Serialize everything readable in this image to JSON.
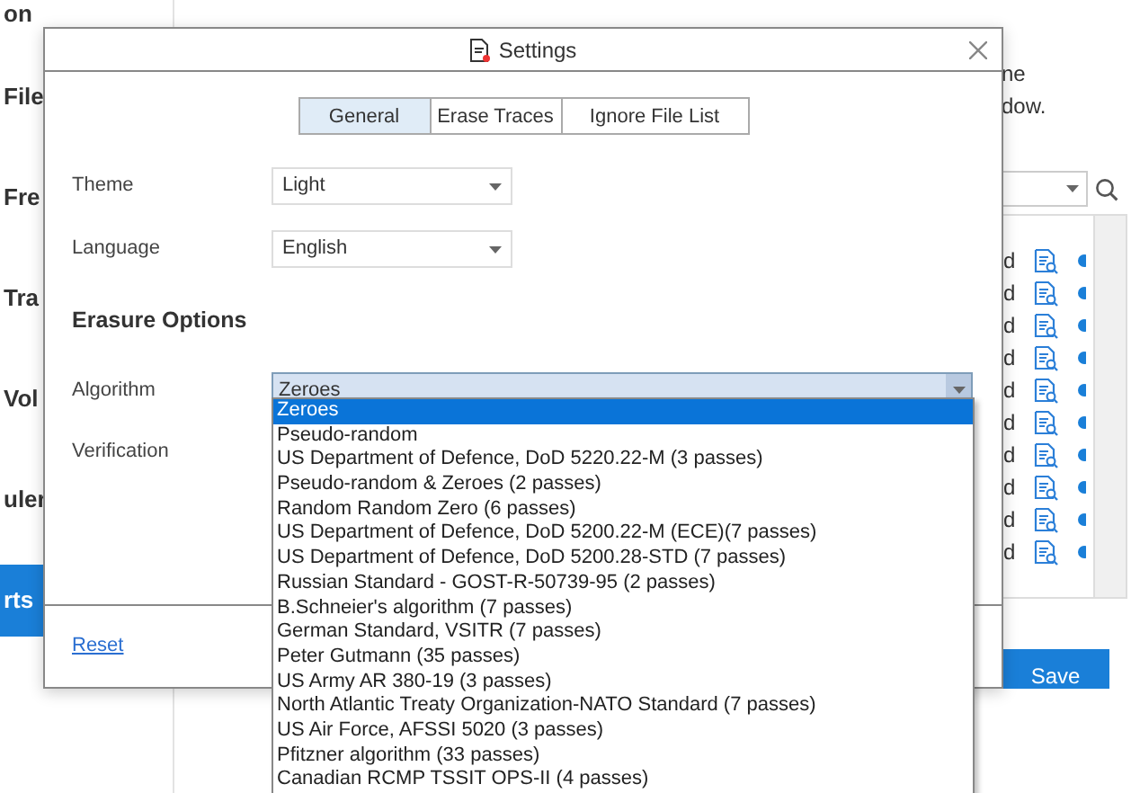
{
  "background": {
    "sidebar": [
      {
        "label": "on",
        "selected": false
      },
      {
        "label": "File",
        "selected": false
      },
      {
        "label": "Fre",
        "selected": false
      },
      {
        "label": "Tra",
        "selected": false
      },
      {
        "label": "Vol",
        "selected": false
      },
      {
        "label": "uler",
        "selected": false
      },
      {
        "label": "rts",
        "selected": true
      }
    ],
    "description": [
      "ne",
      "dow."
    ],
    "table_rows": [
      {
        "cell": "d"
      },
      {
        "cell": "d"
      },
      {
        "cell": "d"
      },
      {
        "cell": "d"
      },
      {
        "cell": "d"
      },
      {
        "cell": "d"
      },
      {
        "cell": "d"
      },
      {
        "cell": "d"
      },
      {
        "cell": "d"
      },
      {
        "cell": "d"
      }
    ],
    "save_button": "Save"
  },
  "dialog": {
    "title": "Settings",
    "tabs": [
      {
        "label": "General",
        "selected": true
      },
      {
        "label": "Erase Traces",
        "selected": false
      },
      {
        "label": "Ignore File List",
        "selected": false
      }
    ],
    "fields": [
      {
        "label": "Theme",
        "value": "Light"
      },
      {
        "label": "Language",
        "value": "English"
      }
    ],
    "section": "Erasure Options",
    "algorithm": {
      "label": "Algorithm",
      "value": "Zeroes",
      "expanded": true,
      "options": [
        {
          "label": "Zeroes",
          "selected": true
        },
        {
          "label": "Pseudo-random",
          "selected": false
        },
        {
          "label": "US Department of Defence, DoD 5220.22-M (3 passes)",
          "selected": false
        },
        {
          "label": "Pseudo-random & Zeroes (2 passes)",
          "selected": false
        },
        {
          "label": "Random Random Zero (6 passes)",
          "selected": false
        },
        {
          "label": "US Department of Defence, DoD 5200.22-M (ECE)(7 passes)",
          "selected": false
        },
        {
          "label": "US Department of Defence, DoD 5200.28-STD (7 passes)",
          "selected": false
        },
        {
          "label": "Russian Standard - GOST-R-50739-95 (2 passes)",
          "selected": false
        },
        {
          "label": "B.Schneier's algorithm (7 passes)",
          "selected": false
        },
        {
          "label": "German Standard, VSITR (7 passes)",
          "selected": false
        },
        {
          "label": "Peter Gutmann (35 passes)",
          "selected": false
        },
        {
          "label": "US Army AR 380-19 (3 passes)",
          "selected": false
        },
        {
          "label": "North Atlantic Treaty Organization-NATO Standard (7 passes)",
          "selected": false
        },
        {
          "label": "US Air Force, AFSSI 5020 (3 passes)",
          "selected": false
        },
        {
          "label": "Pfitzner algorithm (33 passes)",
          "selected": false
        },
        {
          "label": "Canadian RCMP TSSIT OPS-II (4 passes)",
          "selected": false
        }
      ]
    },
    "verification": {
      "label": "Verification"
    },
    "reset_link": "Reset"
  }
}
